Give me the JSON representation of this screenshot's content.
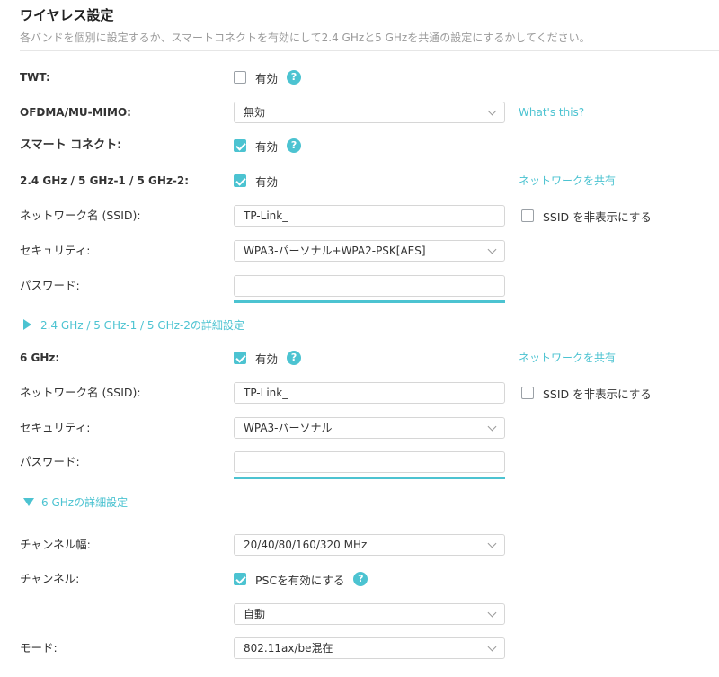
{
  "header": {
    "title": "ワイヤレス設定",
    "description": "各バンドを個別に設定するか、スマートコネクトを有効にして2.4 GHzと5 GHzを共通の設定にするかしてください。"
  },
  "colors": {
    "accent": "#4cc3d1"
  },
  "twt": {
    "label": "TWT:",
    "checkbox_label": "有効",
    "checked": false
  },
  "ofdma": {
    "label": "OFDMA/MU-MIMO:",
    "value": "無効",
    "link": "What's this?"
  },
  "smart_connect": {
    "label": "スマート コネクト:",
    "checkbox_label": "有効",
    "checked": true
  },
  "band24": {
    "label": "2.4 GHz / 5 GHz-1 / 5 GHz-2:",
    "checkbox_label": "有効",
    "checked": true,
    "share_link": "ネットワークを共有",
    "ssid_label": "ネットワーク名 (SSID):",
    "ssid_value": "TP-Link_",
    "hide_ssid_label": "SSID を非表示にする",
    "security_label": "セキュリティ:",
    "security_value": "WPA3-パーソナル+WPA2-PSK[AES]",
    "password_label": "パスワード:",
    "password_value": "",
    "advanced_label": "2.4 GHz / 5 GHz-1 / 5 GHz-2の詳細設定"
  },
  "band6": {
    "label": "6 GHz:",
    "checkbox_label": "有効",
    "checked": true,
    "share_link": "ネットワークを共有",
    "ssid_label": "ネットワーク名 (SSID):",
    "ssid_value": "TP-Link_",
    "hide_ssid_label": "SSID を非表示にする",
    "security_label": "セキュリティ:",
    "security_value": "WPA3-パーソナル",
    "password_label": "パスワード:",
    "password_value": "",
    "advanced_label": "6 GHzの詳細設定"
  },
  "advanced6": {
    "channel_width_label": "チャンネル幅:",
    "channel_width_value": "20/40/80/160/320 MHz",
    "channel_label": "チャンネル:",
    "psc_label": "PSCを有効にする",
    "psc_checked": true,
    "channel_value": "自動",
    "mode_label": "モード:",
    "mode_value": "802.11ax/be混在"
  },
  "icons": {
    "help": "help-icon",
    "chevron": "chevron-down-icon",
    "expand": "triangle-right-icon",
    "collapse": "triangle-down-icon"
  }
}
